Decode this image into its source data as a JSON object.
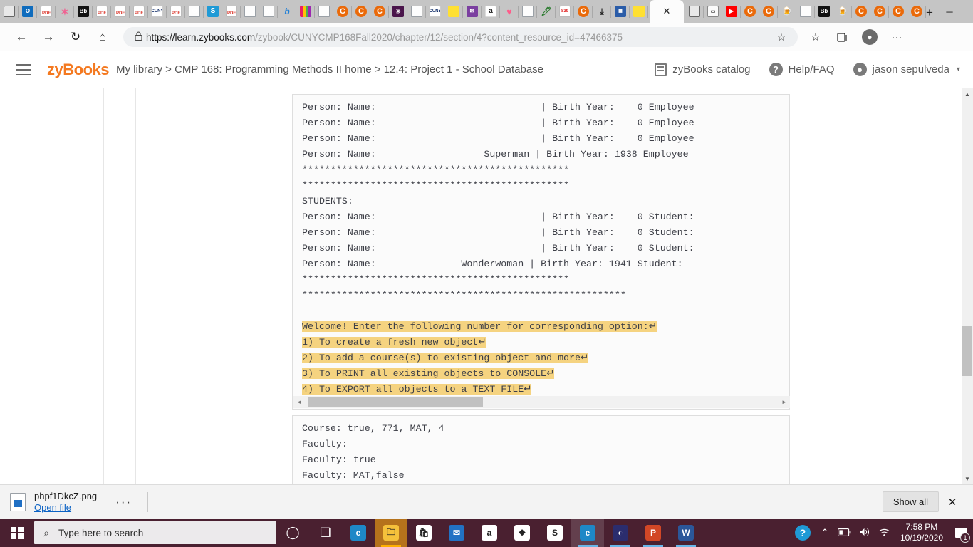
{
  "browser": {
    "tabs_left": [
      {
        "name": "phone-icon",
        "class": "ico-phone",
        "label": ""
      },
      {
        "name": "outlook-icon",
        "class": "ico-outlook",
        "label": "O"
      },
      {
        "name": "pdf-icon",
        "class": "ico-pdf",
        "label": "PDF"
      },
      {
        "name": "star-icon",
        "class": "ico-star",
        "label": "✶"
      },
      {
        "name": "blackboard-icon",
        "class": "ico-bb",
        "label": "Bb"
      },
      {
        "name": "pdf-icon",
        "class": "ico-pdf",
        "label": "PDF"
      },
      {
        "name": "pdf-icon",
        "class": "ico-pdf",
        "label": "PDF"
      },
      {
        "name": "pdf-icon",
        "class": "ico-pdf",
        "label": "PDF"
      },
      {
        "name": "cuny-icon",
        "class": "ico-cuny",
        "label": "CUNY"
      },
      {
        "name": "pdf-icon",
        "class": "ico-pdf",
        "label": "PDF"
      },
      {
        "name": "power-icon",
        "class": "ico-doc",
        "label": "⏻"
      },
      {
        "name": "skype-icon",
        "class": "ico-s",
        "label": "S"
      },
      {
        "name": "pdf-icon",
        "class": "ico-pdf",
        "label": "PDF"
      },
      {
        "name": "document-icon",
        "class": "ico-doc",
        "label": ""
      },
      {
        "name": "wolfram-icon",
        "class": "ico-doc",
        "label": "W"
      },
      {
        "name": "bing-icon",
        "class": "ico-b",
        "label": "b"
      },
      {
        "name": "books-icon",
        "class": "ico-books",
        "label": ""
      },
      {
        "name": "document-icon",
        "class": "ico-doc",
        "label": ""
      },
      {
        "name": "canvas-icon",
        "class": "ico-orange",
        "label": "C"
      },
      {
        "name": "canvas-icon",
        "class": "ico-orange",
        "label": "C"
      },
      {
        "name": "canvas-icon",
        "class": "ico-orange",
        "label": "C"
      },
      {
        "name": "slack-icon",
        "class": "ico-slack",
        "label": "✳"
      },
      {
        "name": "document-icon",
        "class": "ico-doc",
        "label": ""
      },
      {
        "name": "cuny-icon",
        "class": "ico-cuny",
        "label": "CUNY"
      },
      {
        "name": "note-icon",
        "class": "ico-yellow",
        "label": ""
      },
      {
        "name": "mail-icon",
        "class": "ico-mail",
        "label": "✉"
      },
      {
        "name": "amazon-icon",
        "class": "ico-amz",
        "label": "a"
      },
      {
        "name": "heart-icon",
        "class": "ico-heart",
        "label": "♥"
      },
      {
        "name": "document-icon",
        "class": "ico-doc",
        "label": ""
      },
      {
        "name": "feather-icon",
        "class": "ico-feather",
        "label": "🖊"
      },
      {
        "name": "counter-icon",
        "class": "ico-839",
        "label": "839"
      },
      {
        "name": "canvas-icon",
        "class": "ico-orange",
        "label": "C"
      },
      {
        "name": "download-icon",
        "class": "ico-dl",
        "label": "⤓"
      },
      {
        "name": "picture-icon",
        "class": "ico-blue",
        "label": "▦"
      },
      {
        "name": "note-icon",
        "class": "ico-yellow",
        "label": ""
      }
    ],
    "active_tab": {
      "close_label": "✕"
    },
    "tabs_right": [
      {
        "name": "phone-icon",
        "class": "ico-phone",
        "label": ""
      },
      {
        "name": "terminal-icon",
        "class": "ico-term",
        "label": "▭"
      },
      {
        "name": "youtube-icon",
        "class": "ico-yt",
        "label": "▶"
      },
      {
        "name": "canvas-icon",
        "class": "ico-orange",
        "label": "C"
      },
      {
        "name": "canvas-icon",
        "class": "ico-orange",
        "label": "C"
      },
      {
        "name": "beer-icon",
        "class": "ico-beer",
        "label": "🍺"
      },
      {
        "name": "document-icon",
        "class": "ico-doc",
        "label": ""
      },
      {
        "name": "blackboard-icon",
        "class": "ico-bb",
        "label": "Bb"
      },
      {
        "name": "beer-icon",
        "class": "ico-beer",
        "label": "🍺"
      },
      {
        "name": "canvas-icon",
        "class": "ico-orange",
        "label": "C"
      },
      {
        "name": "canvas-icon",
        "class": "ico-orange",
        "label": "C"
      },
      {
        "name": "canvas-icon",
        "class": "ico-orange",
        "label": "C"
      },
      {
        "name": "canvas-icon",
        "class": "ico-orange",
        "label": "C"
      }
    ],
    "new_tab_label": "+",
    "window": {
      "minimize": "─",
      "maximize": "❐",
      "close": "✕"
    },
    "nav": {
      "back": "←",
      "forward": "→",
      "reload": "↻",
      "home": "⌂"
    },
    "address": {
      "lock": "🔒",
      "url_bold": "https://learn.zybooks.com",
      "url_rest": "/zybook/CUNYCMP168Fall2020/chapter/12/section/4?content_resource_id=47466375",
      "favorite": "☆"
    },
    "nav_right": {
      "collections": "⛉",
      "favorites": "☆",
      "profile": "◉",
      "settings": "···"
    }
  },
  "zyheader": {
    "logo_zy": "zy",
    "logo_books": "Books",
    "breadcrumb": "My library > CMP 168: Programming Methods II home > 12.4: Project 1 - School Database",
    "catalog_label": "zyBooks catalog",
    "help_label": "Help/FAQ",
    "user_label": "jason sepulveda",
    "caret": "▾"
  },
  "console": {
    "block1_lines": [
      {
        "text": "Person: Name:                             | Birth Year:    0 Employee",
        "highlight": false
      },
      {
        "text": "Person: Name:                             | Birth Year:    0 Employee",
        "highlight": false
      },
      {
        "text": "Person: Name:                             | Birth Year:    0 Employee",
        "highlight": false
      },
      {
        "text": "Person: Name:                   Superman | Birth Year: 1938 Employee",
        "highlight": false
      },
      {
        "text": "***********************************************",
        "highlight": false
      },
      {
        "text": "***********************************************",
        "highlight": false
      },
      {
        "text": "STUDENTS:",
        "highlight": false
      },
      {
        "text": "Person: Name:                             | Birth Year:    0 Student:",
        "highlight": false
      },
      {
        "text": "Person: Name:                             | Birth Year:    0 Student:",
        "highlight": false
      },
      {
        "text": "Person: Name:                             | Birth Year:    0 Student:",
        "highlight": false
      },
      {
        "text": "Person: Name:               Wonderwoman | Birth Year: 1941 Student:",
        "highlight": false
      },
      {
        "text": "***********************************************",
        "highlight": false
      },
      {
        "text": "*********************************************************",
        "highlight": false
      },
      {
        "text": "",
        "highlight": false
      },
      {
        "text": "Welcome! Enter the following number for corresponding option:↵",
        "highlight": true
      },
      {
        "text": "1) To create a fresh new object↵",
        "highlight": true
      },
      {
        "text": "2) To add a course(s) to existing object and more↵",
        "highlight": true
      },
      {
        "text": "3) To PRINT all existing objects to CONSOLE↵",
        "highlight": true
      },
      {
        "text": "4) To EXPORT all objects to a TEXT FILE↵",
        "highlight": true
      }
    ],
    "block2_lines": [
      "Course: true, 771, MAT, 4",
      "Faculty:",
      "Faculty: true",
      "Faculty: MAT,false"
    ],
    "hscroll": {
      "left_arrow": "◄",
      "right_arrow": "►"
    },
    "vscroll": {
      "up_arrow": "▲",
      "down_arrow": "▼"
    }
  },
  "download_bar": {
    "file_name": "phpf1DkcZ.png",
    "open_label": "Open file",
    "more_label": "···",
    "show_all_label": "Show all",
    "close_label": "✕"
  },
  "taskbar": {
    "search_placeholder": "Type here to search",
    "search_icon": "⌕",
    "cortana_icon": "◯",
    "taskview_icon": "❏",
    "apps": [
      {
        "name": "edge-icon",
        "label": "e",
        "color": "#1e88c7"
      },
      {
        "name": "file-explorer-icon",
        "label": "🗀",
        "color": "#f5c13b"
      },
      {
        "name": "microsoft-store-icon",
        "label": "🛍",
        "color": "#ffffff"
      },
      {
        "name": "mail-icon",
        "label": "✉",
        "color": "#2272c4"
      },
      {
        "name": "amazon-icon",
        "label": "a",
        "color": "#ffffff"
      },
      {
        "name": "dropbox-icon",
        "label": "❖",
        "color": "#ffffff"
      },
      {
        "name": "shazam-icon",
        "label": "S",
        "color": "#ffffff"
      },
      {
        "name": "edge-icon",
        "label": "e",
        "color": "#1e88c7"
      },
      {
        "name": "eclipse-icon",
        "label": "◐",
        "color": "#2b2d6e"
      },
      {
        "name": "powerpoint-icon",
        "label": "P",
        "color": "#d24726"
      },
      {
        "name": "word-icon",
        "label": "W",
        "color": "#2b579a"
      }
    ],
    "tray": {
      "help_icon": "?",
      "chevron_icon": "⌃",
      "battery_icon": "▭",
      "volume_icon": "🔊",
      "wifi_icon": "📶",
      "time": "7:58 PM",
      "date": "10/19/2020",
      "notification_count": "1"
    }
  },
  "colors": {
    "accent_orange": "#f47920",
    "highlight_yellow": "#f5d380",
    "taskbar": "#4a2030",
    "link_blue": "#0b62c4"
  }
}
